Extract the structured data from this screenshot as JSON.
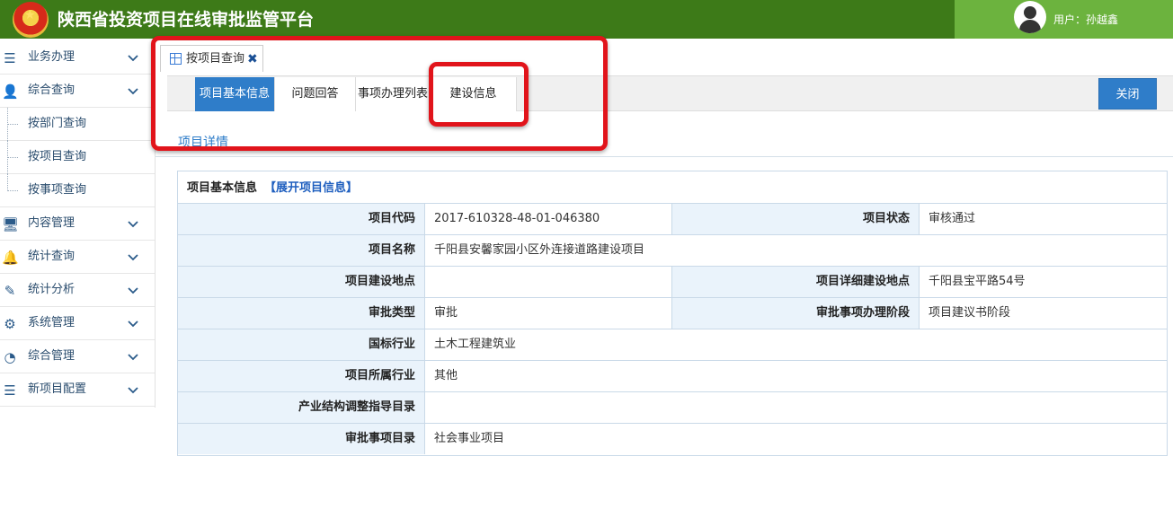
{
  "header": {
    "title": "陕西省投资项目在线审批监管平台",
    "user_label": "用户：孙越鑫",
    "left_color": "#3d7a18",
    "right_color": "#6cb33e"
  },
  "sidebar": {
    "items": [
      {
        "label": "业务办理",
        "icon": "list-icon"
      },
      {
        "label": "综合查询",
        "icon": "user-icon"
      },
      {
        "label": "按部门查询",
        "sub": true
      },
      {
        "label": "按项目查询",
        "sub": true
      },
      {
        "label": "按事项查询",
        "sub": true
      },
      {
        "label": "内容管理",
        "icon": "monitor-icon"
      },
      {
        "label": "统计查询",
        "icon": "bell-icon"
      },
      {
        "label": "统计分析",
        "icon": "edit-icon"
      },
      {
        "label": "系统管理",
        "icon": "gear-icon"
      },
      {
        "label": "综合管理",
        "icon": "dashboard-icon"
      },
      {
        "label": "新项目配置",
        "icon": "list-icon"
      }
    ]
  },
  "tabs": {
    "doc_tab": "按项目查询",
    "doc_tab_close": "✖",
    "subtabs": [
      "项目基本信息",
      "问题回答",
      "事项办理列表",
      "建设信息"
    ],
    "active_subtab": 0,
    "close_button": "关闭"
  },
  "section_title": "项目详情",
  "info": {
    "title": "项目基本信息",
    "expand_link": "【展开项目信息】",
    "rows": [
      {
        "l1": "项目代码",
        "v1": "2017-610328-48-01-046380",
        "l2": "项目状态",
        "v2": "审核通过"
      },
      {
        "l1": "项目名称",
        "v1": "千阳县安馨家园小区外连接道路建设项目"
      },
      {
        "l1": "项目建设地点",
        "v1": "",
        "l2": "项目详细建设地点",
        "v2": "千阳县宝平路54号"
      },
      {
        "l1": "审批类型",
        "v1": "审批",
        "l2": "审批事项办理阶段",
        "v2": "项目建议书阶段"
      },
      {
        "l1": "国标行业",
        "v1": "土木工程建筑业"
      },
      {
        "l1": "项目所属行业",
        "v1": "其他"
      },
      {
        "l1": "产业结构调整指导目录",
        "v1": ""
      },
      {
        "l1": "审批事项目录",
        "v1": "社会事业项目"
      }
    ]
  },
  "colors": {
    "accent": "#2f7dc9",
    "highlight": "#e1141b",
    "label_bg": "#eaf3fb"
  }
}
